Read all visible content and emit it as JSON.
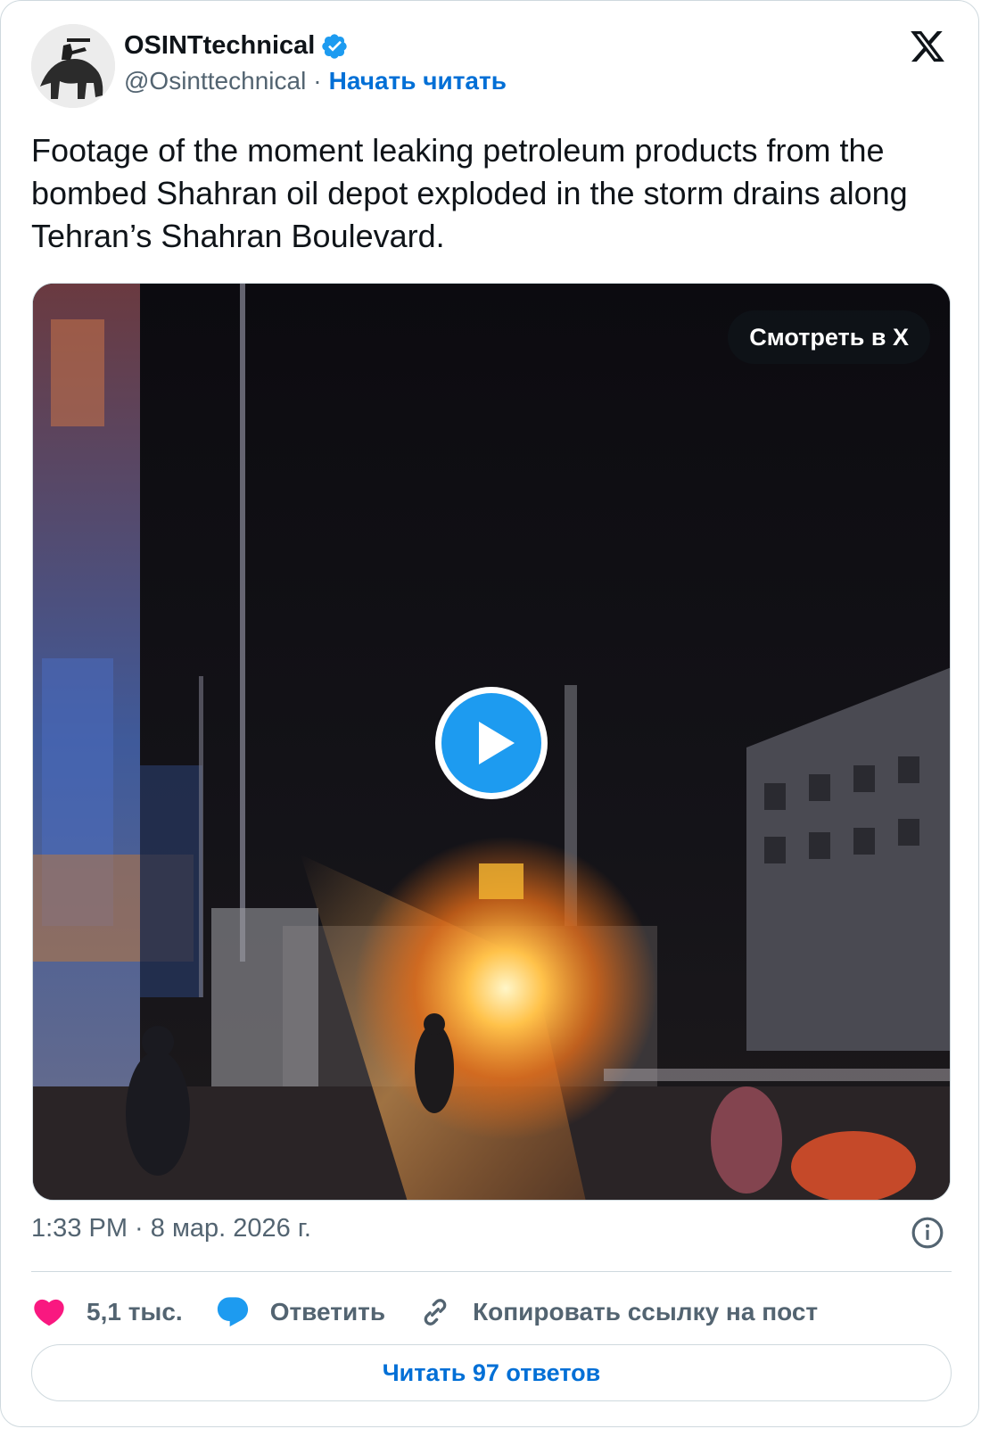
{
  "author": {
    "name": "OSINTtechnical",
    "handle": "@Osinttechnical",
    "separator": "·",
    "follow_label": "Начать читать",
    "verified": true
  },
  "tweet": {
    "text": "Footage of the moment leaking petroleum products from the bombed Shahran oil depot exploded in the storm drains along Tehran’s Shahran Boulevard."
  },
  "media": {
    "watch_label": "Смотреть в X",
    "play_icon": "play-icon"
  },
  "meta": {
    "timestamp": "1:33 PM · 8 мар. 2026 г."
  },
  "actions": {
    "likes": "5,1 тыс.",
    "reply_label": "Ответить",
    "copy_link_label": "Копировать ссылку на пост"
  },
  "read_replies_label": "Читать 97 ответов",
  "colors": {
    "accent": "#006fd6",
    "verified": "#1d9bf0",
    "like": "#f91880",
    "muted": "#536471",
    "border": "#cfd9de"
  }
}
